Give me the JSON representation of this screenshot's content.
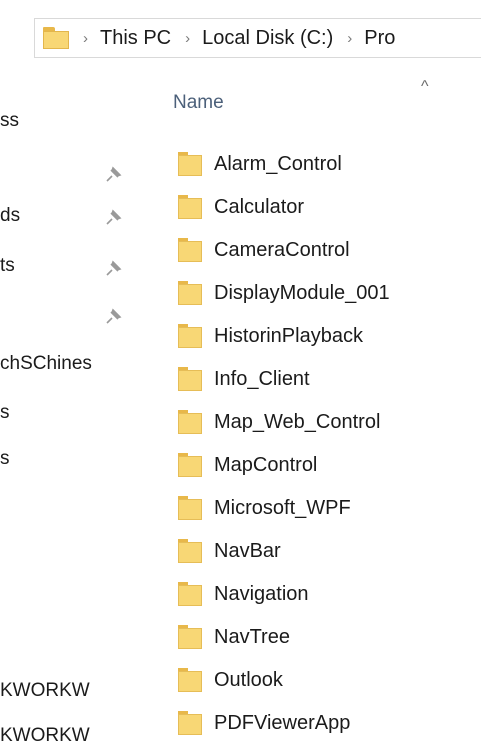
{
  "address_bar": {
    "breadcrumbs": [
      "This PC",
      "Local Disk (C:)",
      "Pro"
    ],
    "separator": ">"
  },
  "nav_pane": {
    "items": [
      {
        "label": "ss",
        "pinned": false
      },
      {
        "label": "",
        "pinned": true
      },
      {
        "label": "ds",
        "pinned": true
      },
      {
        "label": "ts",
        "pinned": true
      },
      {
        "label": "",
        "pinned": true
      },
      {
        "label": "chSChines",
        "pinned": false
      },
      {
        "label": "s",
        "pinned": false
      },
      {
        "label": "s",
        "pinned": false
      },
      {
        "label": "KWORKW",
        "pinned": false
      },
      {
        "label": "KWORKW",
        "pinned": false
      }
    ]
  },
  "file_list": {
    "column_header": "Name",
    "sort_indicator": "^",
    "folders": [
      "Alarm_Control",
      "Calculator",
      "CameraControl",
      "DisplayModule_001",
      "HistorinPlayback",
      "Info_Client",
      "Map_Web_Control",
      "MapControl",
      "Microsoft_WPF",
      "NavBar",
      "Navigation",
      "NavTree",
      "Outlook",
      "PDFViewerApp"
    ]
  },
  "colors": {
    "folder_fill": "#f8d775",
    "folder_tab": "#e8b84a",
    "header_text": "#4c607a"
  }
}
